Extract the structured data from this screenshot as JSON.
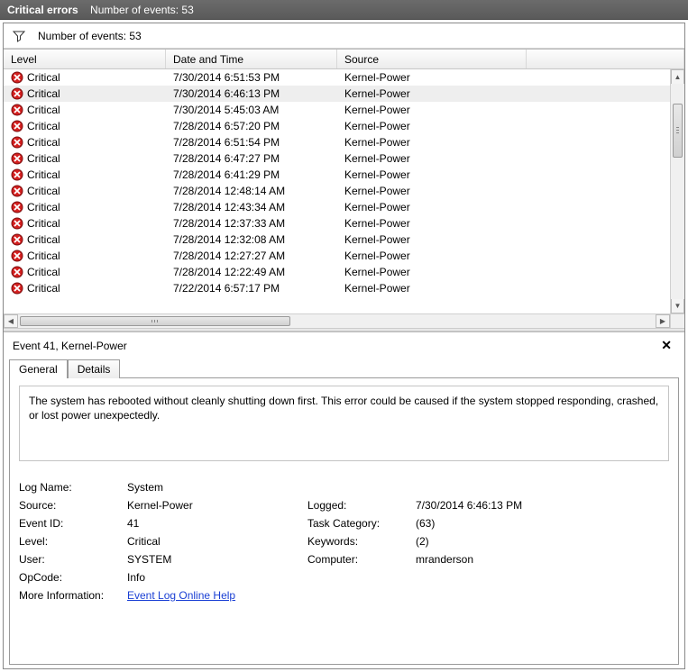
{
  "title": {
    "main": "Critical errors",
    "count_label": "Number of events: 53"
  },
  "filter": {
    "count_label": "Number of events: 53"
  },
  "columns": {
    "level": "Level",
    "date": "Date and Time",
    "source": "Source"
  },
  "rows": [
    {
      "level": "Critical",
      "date": "7/30/2014 6:51:53 PM",
      "source": "Kernel-Power",
      "selected": false
    },
    {
      "level": "Critical",
      "date": "7/30/2014 6:46:13 PM",
      "source": "Kernel-Power",
      "selected": true
    },
    {
      "level": "Critical",
      "date": "7/30/2014 5:45:03 AM",
      "source": "Kernel-Power",
      "selected": false
    },
    {
      "level": "Critical",
      "date": "7/28/2014 6:57:20 PM",
      "source": "Kernel-Power",
      "selected": false
    },
    {
      "level": "Critical",
      "date": "7/28/2014 6:51:54 PM",
      "source": "Kernel-Power",
      "selected": false
    },
    {
      "level": "Critical",
      "date": "7/28/2014 6:47:27 PM",
      "source": "Kernel-Power",
      "selected": false
    },
    {
      "level": "Critical",
      "date": "7/28/2014 6:41:29 PM",
      "source": "Kernel-Power",
      "selected": false
    },
    {
      "level": "Critical",
      "date": "7/28/2014 12:48:14 AM",
      "source": "Kernel-Power",
      "selected": false
    },
    {
      "level": "Critical",
      "date": "7/28/2014 12:43:34 AM",
      "source": "Kernel-Power",
      "selected": false
    },
    {
      "level": "Critical",
      "date": "7/28/2014 12:37:33 AM",
      "source": "Kernel-Power",
      "selected": false
    },
    {
      "level": "Critical",
      "date": "7/28/2014 12:32:08 AM",
      "source": "Kernel-Power",
      "selected": false
    },
    {
      "level": "Critical",
      "date": "7/28/2014 12:27:27 AM",
      "source": "Kernel-Power",
      "selected": false
    },
    {
      "level": "Critical",
      "date": "7/28/2014 12:22:49 AM",
      "source": "Kernel-Power",
      "selected": false
    },
    {
      "level": "Critical",
      "date": "7/22/2014 6:57:17 PM",
      "source": "Kernel-Power",
      "selected": false
    }
  ],
  "detail": {
    "header": "Event 41, Kernel-Power",
    "tabs": {
      "general": "General",
      "details": "Details"
    },
    "description": "The system has rebooted without cleanly shutting down first. This error could be caused if the system stopped responding, crashed, or lost power unexpectedly.",
    "labels": {
      "log_name": "Log Name:",
      "source": "Source:",
      "event_id": "Event ID:",
      "level": "Level:",
      "user": "User:",
      "opcode": "OpCode:",
      "more_info": "More Information:",
      "logged": "Logged:",
      "task_category": "Task Category:",
      "keywords": "Keywords:",
      "computer": "Computer:"
    },
    "values": {
      "log_name": "System",
      "source": "Kernel-Power",
      "event_id": "41",
      "level": "Critical",
      "user": "SYSTEM",
      "opcode": "Info",
      "more_info_link": "Event Log Online Help",
      "logged": "7/30/2014 6:46:13 PM",
      "task_category": "(63)",
      "keywords": "(2)",
      "computer": "mranderson"
    }
  }
}
